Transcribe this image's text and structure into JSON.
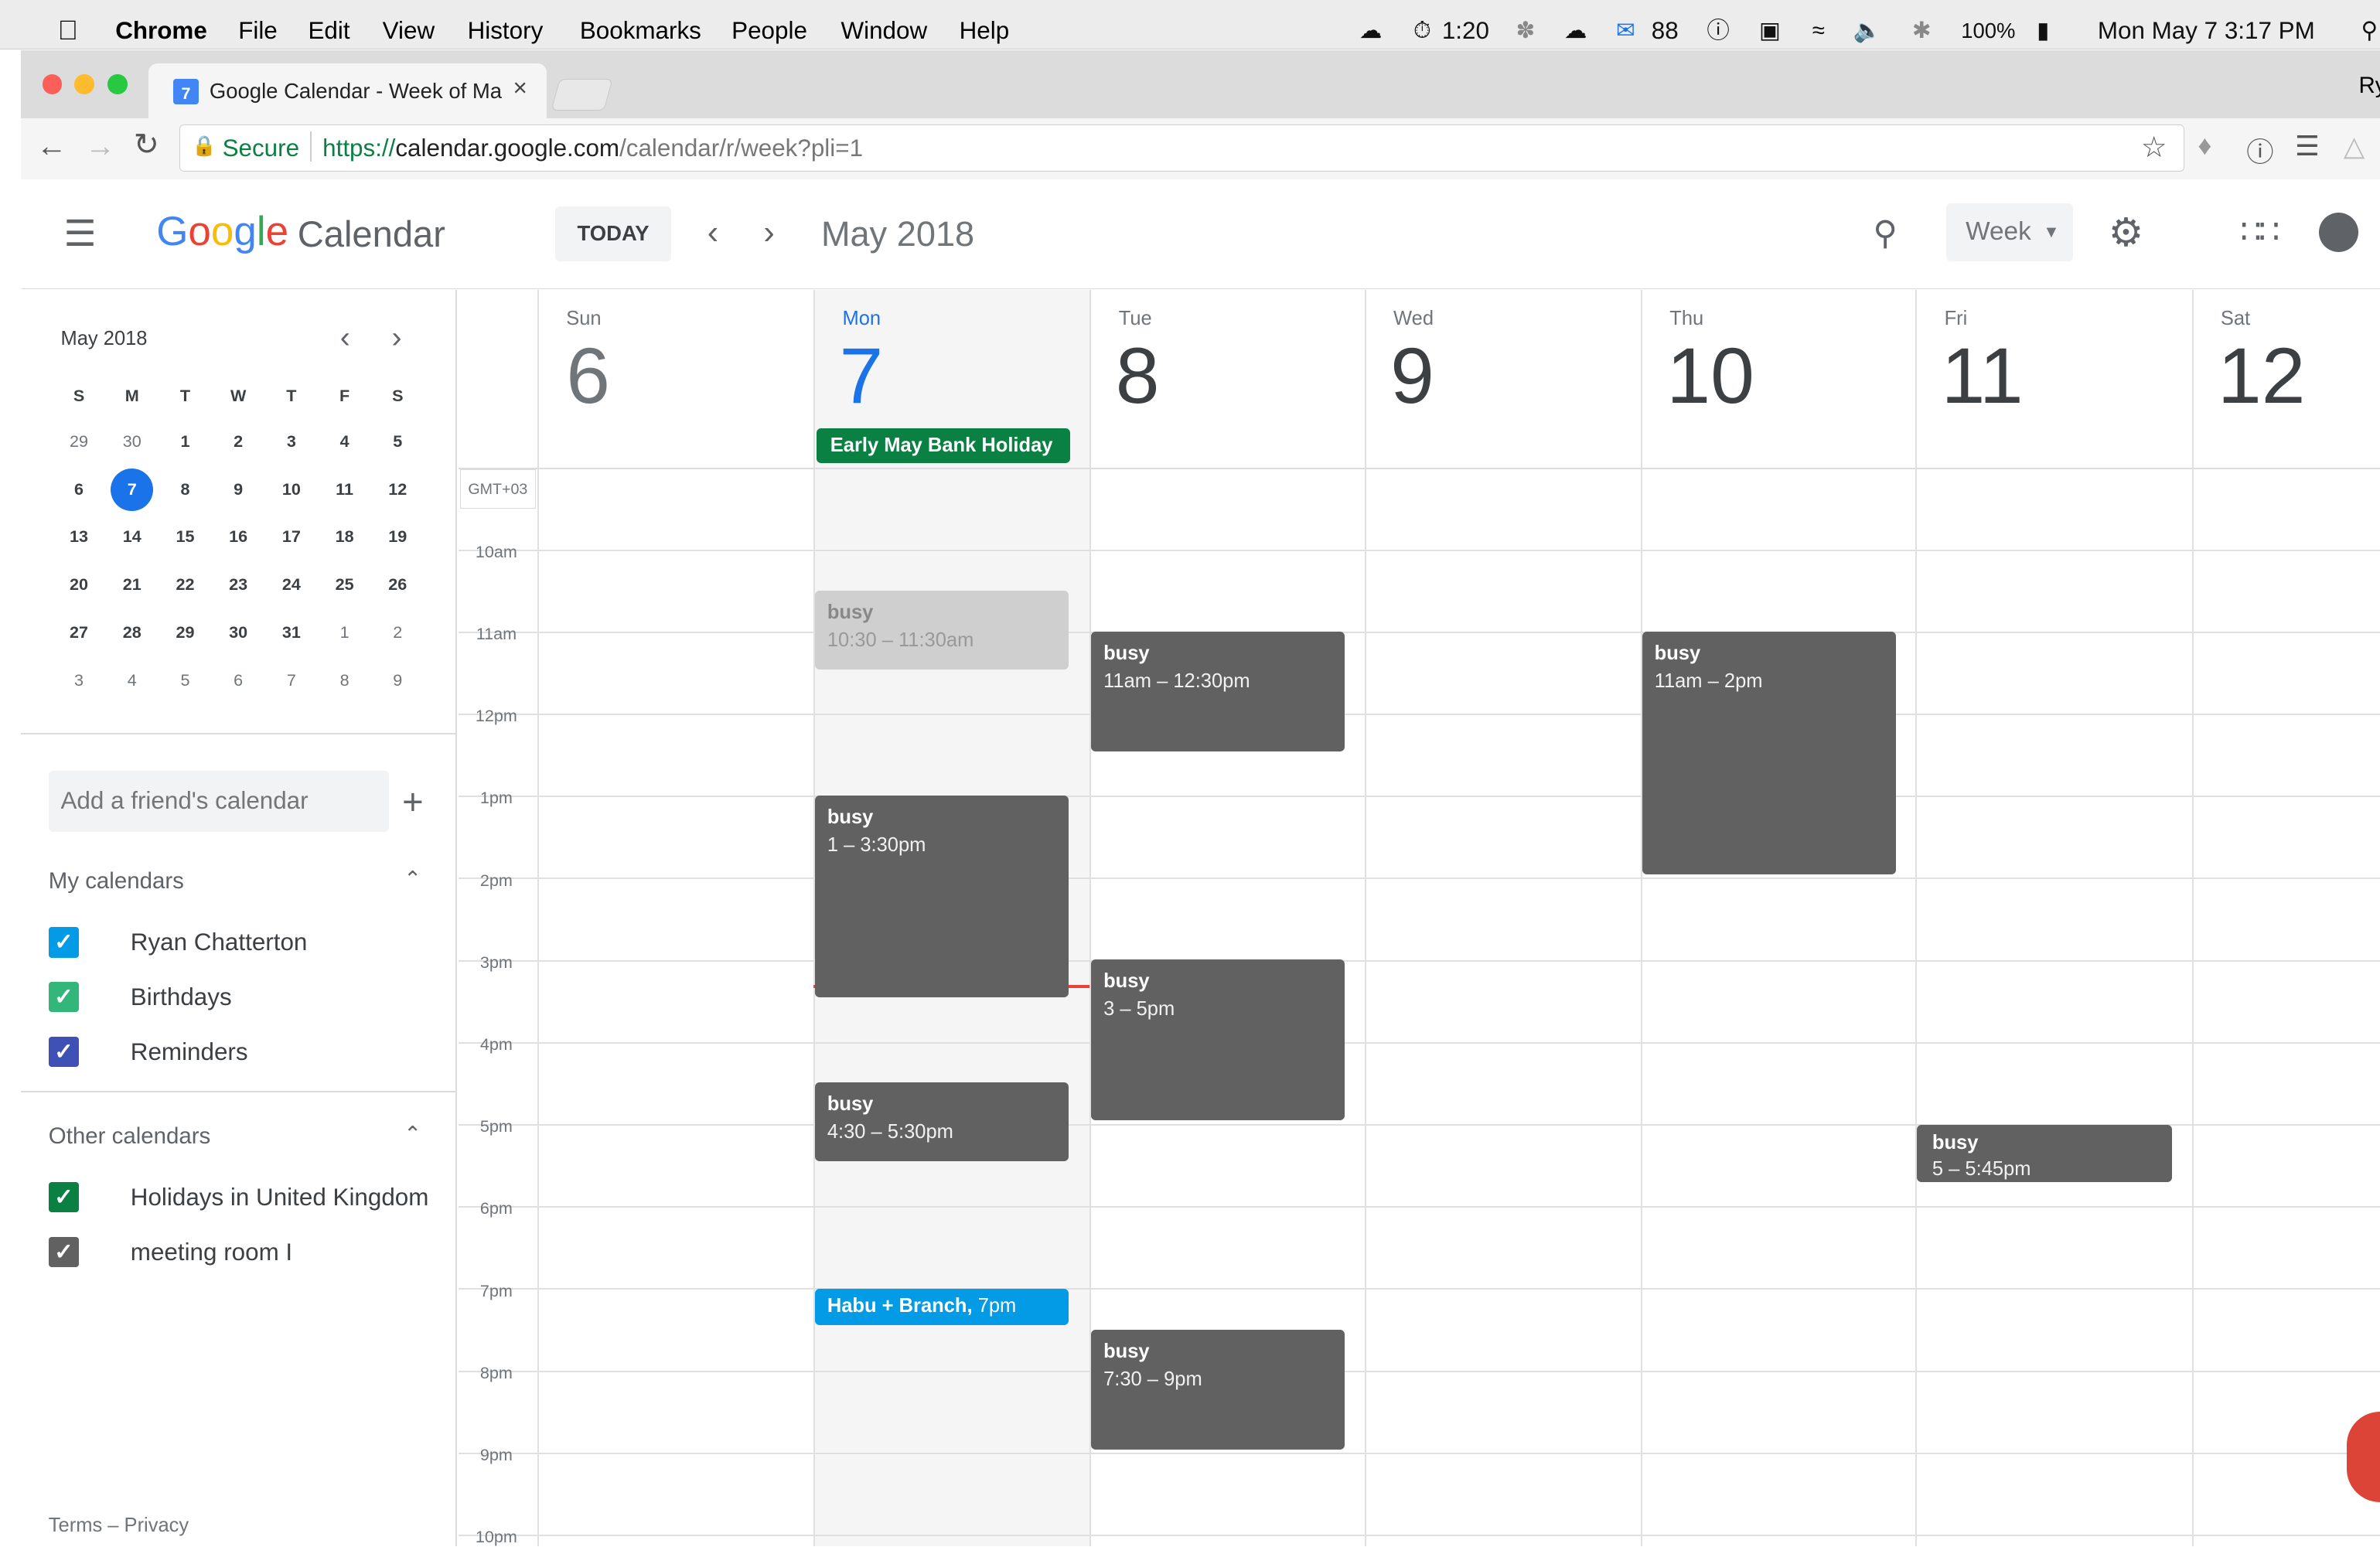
{
  "menubar": {
    "app": "Chrome",
    "menus": [
      "File",
      "Edit",
      "View",
      "History",
      "Bookmarks",
      "People",
      "Window",
      "Help"
    ],
    "timer": "1:20",
    "mail_count": "88",
    "battery": "100%",
    "clock": "Mon May 7  3:17 PM",
    "user_fragment": "Ry"
  },
  "tab": {
    "title": "Google Calendar - Week of Ma",
    "favicon_day": "7"
  },
  "omnibox": {
    "secure_label": "Secure",
    "url_scheme": "https://",
    "url_host": "calendar.google.com",
    "url_path": "/calendar/r/week?pli=1"
  },
  "header": {
    "logo_google": [
      "G",
      "o",
      "o",
      "g",
      "l",
      "e"
    ],
    "logo_colors": [
      "#4285f4",
      "#ea4335",
      "#fbbc05",
      "#4285f4",
      "#34a853",
      "#ea4335"
    ],
    "logo_calendar": "Calendar",
    "today_label": "TODAY",
    "period": "May 2018",
    "view_label": "Week"
  },
  "mini_calendar": {
    "title": "May 2018",
    "weekdays": [
      "S",
      "M",
      "T",
      "W",
      "T",
      "F",
      "S"
    ],
    "weeks": [
      [
        "29",
        "30",
        "1",
        "2",
        "3",
        "4",
        "5"
      ],
      [
        "6",
        "7",
        "8",
        "9",
        "10",
        "11",
        "12"
      ],
      [
        "13",
        "14",
        "15",
        "16",
        "17",
        "18",
        "19"
      ],
      [
        "20",
        "21",
        "22",
        "23",
        "24",
        "25",
        "26"
      ],
      [
        "27",
        "28",
        "29",
        "30",
        "31",
        "1",
        "2"
      ],
      [
        "3",
        "4",
        "5",
        "6",
        "7",
        "8",
        "9"
      ]
    ],
    "selected": "7"
  },
  "sidebar": {
    "add_friend_placeholder": "Add a friend's calendar",
    "my_calendars_title": "My calendars",
    "my_calendars": [
      {
        "name": "Ryan Chatterton",
        "color": "#039be5"
      },
      {
        "name": "Birthdays",
        "color": "#33b679"
      },
      {
        "name": "Reminders",
        "color": "#3f51b5"
      }
    ],
    "other_calendars_title": "Other calendars",
    "other_calendars": [
      {
        "name": "Holidays in United Kingdom",
        "color": "#0b8043"
      },
      {
        "name": "meeting room I",
        "color": "#616161"
      }
    ],
    "footer": "Terms – Privacy"
  },
  "week": {
    "timezone": "GMT+03",
    "days": [
      {
        "name": "Sun",
        "num": "6"
      },
      {
        "name": "Mon",
        "num": "7",
        "today": true
      },
      {
        "name": "Tue",
        "num": "8"
      },
      {
        "name": "Wed",
        "num": "9"
      },
      {
        "name": "Thu",
        "num": "10"
      },
      {
        "name": "Fri",
        "num": "11"
      },
      {
        "name": "Sat",
        "num": "12"
      }
    ],
    "hours": [
      "10am",
      "11am",
      "12pm",
      "1pm",
      "2pm",
      "3pm",
      "4pm",
      "5pm",
      "6pm",
      "7pm",
      "8pm",
      "9pm",
      "10pm"
    ],
    "all_day": {
      "title": "Early May Bank Holiday",
      "color": "#0b8043"
    },
    "events": {
      "mon_a": {
        "title": "busy",
        "time": "10:30 – 11:30am"
      },
      "mon_b": {
        "title": "busy",
        "time": "1 – 3:30pm"
      },
      "mon_c": {
        "title": "busy",
        "time": "4:30 – 5:30pm"
      },
      "mon_d": {
        "title": "Habu + Branch,",
        "time": "7pm"
      },
      "tue_a": {
        "title": "busy",
        "time": "11am – 12:30pm"
      },
      "tue_b": {
        "title": "busy",
        "time": "3 – 5pm"
      },
      "tue_c": {
        "title": "busy",
        "time": "7:30 – 9pm"
      },
      "thu_a": {
        "title": "busy",
        "time": "11am – 2pm"
      },
      "fri_a": {
        "title": "busy",
        "time": "5 – 5:45pm"
      }
    }
  }
}
